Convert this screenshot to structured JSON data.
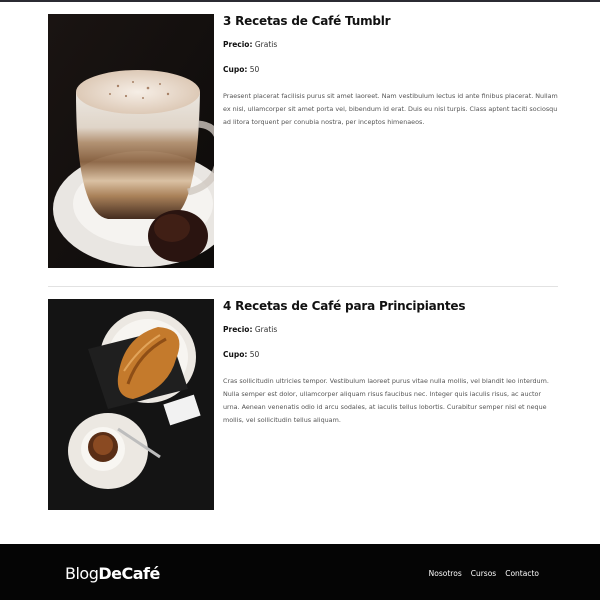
{
  "posts": [
    {
      "title": "3 Recetas de Café Tumblr",
      "price_label": "Precio:",
      "price_value": "Gratis",
      "cupo_label": "Cupo:",
      "cupo_value": "50",
      "description": "Praesent placerat facilisis purus sit amet laoreet. Nam vestibulum lectus id ante finibus placerat. Nullam ex nisl, ullamcorper sit amet porta vel, bibendum id erat. Duis eu nisl turpis. Class aptent taciti sociosqu ad litora torquent per conubia nostra, per inceptos himenaeos.",
      "image_icon": "cappuccino-photo"
    },
    {
      "title": "4 Recetas de Café para Principiantes",
      "price_label": "Precio:",
      "price_value": "Gratis",
      "cupo_label": "Cupo:",
      "cupo_value": "50",
      "description": "Cras sollicitudin ultricies tempor. Vestibulum laoreet purus vitae nulla mollis, vel blandit leo interdum. Nulla semper est dolor, ullamcorper aliquam risus faucibus nec. Integer quis iaculis risus, ac auctor urna. Aenean venenatis odio id arcu sodales, at iaculis tellus lobortis. Curabitur semper nisl et neque mollis, vel sollicitudin tellus aliquam.",
      "image_icon": "croissant-espresso-photo"
    }
  ],
  "footer": {
    "logo_part1": "Blog",
    "logo_part2": "DeCafé",
    "nav": [
      "Nosotros",
      "Cursos",
      "Contacto"
    ],
    "background": "#050505"
  }
}
